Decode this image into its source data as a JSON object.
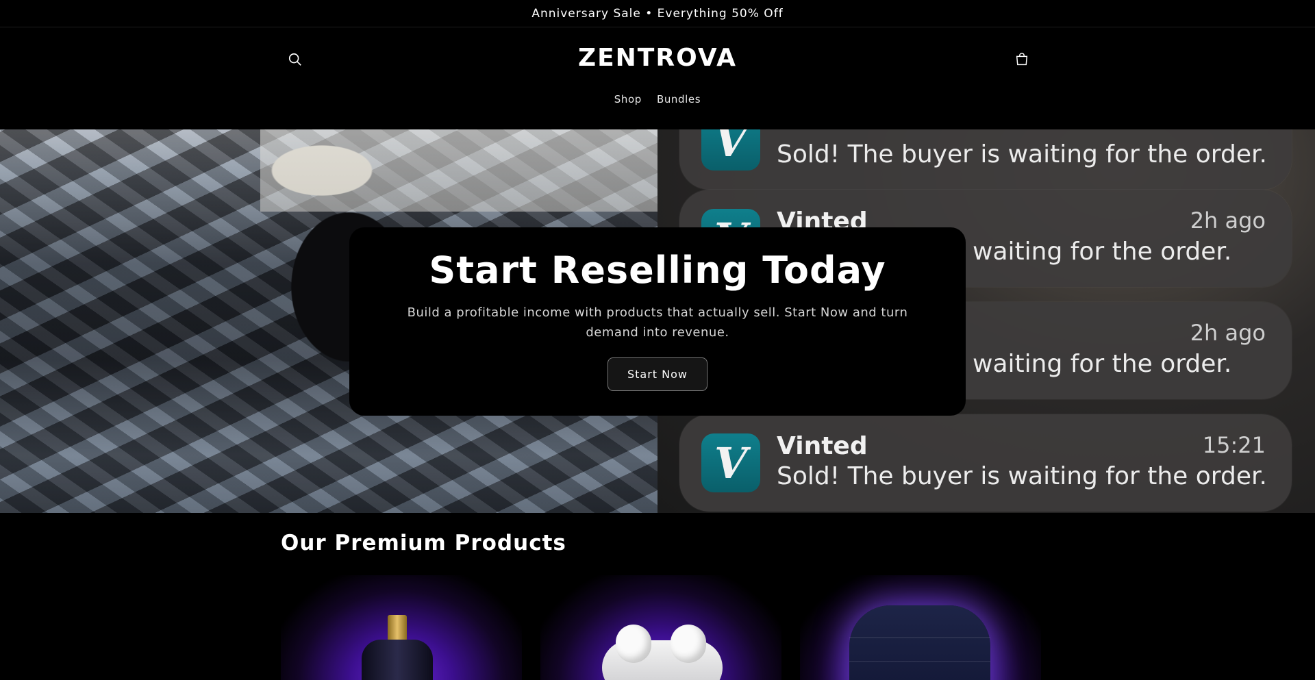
{
  "announcement": {
    "text": "Anniversary Sale • Everything 50% Off"
  },
  "header": {
    "logo": "ZENTROVA",
    "nav": [
      {
        "label": "Shop"
      },
      {
        "label": "Bundles"
      }
    ],
    "icons": {
      "search": "search-icon",
      "cart": "cart-icon"
    }
  },
  "hero": {
    "title": "Start Reselling Today",
    "subtitle": "Build a profitable income with products that actually sell. Start Now and turn demand into revenue.",
    "button_label": "Start Now",
    "notifications": [
      {
        "app": "",
        "message": "Sold! The buyer is waiting for the order.",
        "time": ""
      },
      {
        "app": "Vinted",
        "message": "waiting for the order.",
        "time": "2h ago"
      },
      {
        "app": "",
        "message": "waiting for the order.",
        "time": "2h ago"
      },
      {
        "app": "Vinted",
        "message": "Sold! The buyer is waiting for the order.",
        "time": "15:21"
      }
    ],
    "app_icon_letter": "V"
  },
  "products_section": {
    "title": "Our Premium Products",
    "products": [
      {
        "kind": "perfume"
      },
      {
        "kind": "earbuds"
      },
      {
        "kind": "puffer-jacket"
      }
    ]
  }
}
